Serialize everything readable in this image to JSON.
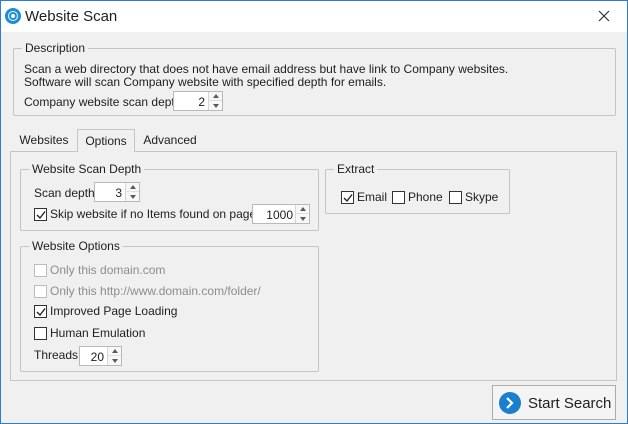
{
  "window": {
    "title": "Website Scan"
  },
  "colors": {
    "accent": "#1b7fd0",
    "border": "#c5c5c5",
    "window_bg": "#f0f0f0",
    "disabled_text": "#8d8d8d"
  },
  "description": {
    "legend": "Description",
    "line1": "Scan a web directory that does not have email address but have link to Company websites.",
    "line2": "Software will scan Company website with specified depth for emails.",
    "depth_label": "Company website scan depth",
    "depth_value": "2"
  },
  "tabs": [
    {
      "label": "Websites",
      "active": false
    },
    {
      "label": "Options",
      "active": true
    },
    {
      "label": "Advanced",
      "active": false
    }
  ],
  "scan_depth_group": {
    "legend": "Website Scan Depth",
    "scan_depth_label": "Scan depth",
    "scan_depth_value": "3",
    "skip_label": "Skip website if no Items found on pages",
    "skip_checked": true,
    "skip_pages_value": "1000"
  },
  "website_options": {
    "legend": "Website Options",
    "only_domain": {
      "label": "Only this domain.com",
      "checked": false,
      "enabled": false
    },
    "only_folder": {
      "label": "Only this http://www.domain.com/folder/",
      "checked": false,
      "enabled": false
    },
    "improved_loading": {
      "label": "Improved Page Loading",
      "checked": true,
      "enabled": true
    },
    "human_emulation": {
      "label": "Human Emulation",
      "checked": false,
      "enabled": true
    },
    "threads_label": "Threads",
    "threads_value": "20"
  },
  "extract": {
    "legend": "Extract",
    "email": {
      "label": "Email",
      "checked": true
    },
    "phone": {
      "label": "Phone",
      "checked": false
    },
    "skype": {
      "label": "Skype",
      "checked": false
    }
  },
  "start_button": {
    "label": "Start Search",
    "icon": "chevron-right-icon"
  }
}
